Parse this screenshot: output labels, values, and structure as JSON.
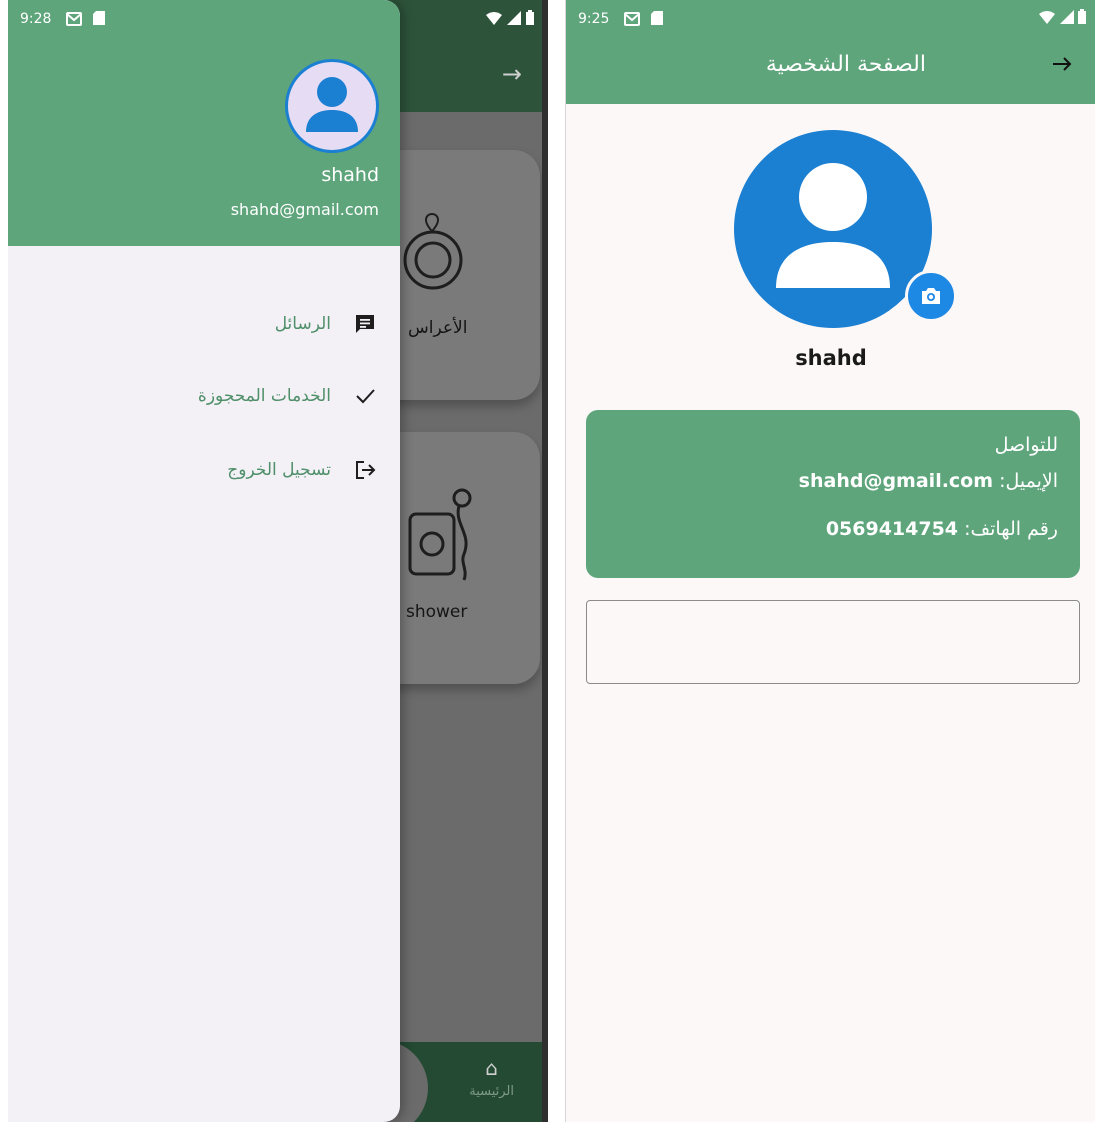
{
  "left_screen": {
    "status_time": "9:28",
    "background": {
      "card1_label": "الأعراس",
      "card2_label": "shower",
      "nav_home_label": "الرئيسية"
    },
    "drawer": {
      "user_name": "shahd",
      "user_email": "shahd@gmail.com",
      "items": [
        {
          "label": "الرسائل",
          "icon": "message-icon"
        },
        {
          "label": "الخدمات المحجوزة",
          "icon": "check-icon"
        },
        {
          "label": "تسجيل الخروج",
          "icon": "logout-icon"
        }
      ]
    }
  },
  "right_screen": {
    "status_time": "9:25",
    "title": "الصفحة الشخصية",
    "user_name": "shahd",
    "contact": {
      "heading": "للتواصل",
      "email_label": "الإيميل: ",
      "email_value": "shahd@gmail.com",
      "phone_label": "رقم الهاتف: ",
      "phone_value": "0569414754"
    },
    "input_value": ""
  },
  "colors": {
    "primary_green": "#5fa57c",
    "avatar_blue": "#1b7fd2",
    "drawer_background": "#f3f1f6"
  }
}
